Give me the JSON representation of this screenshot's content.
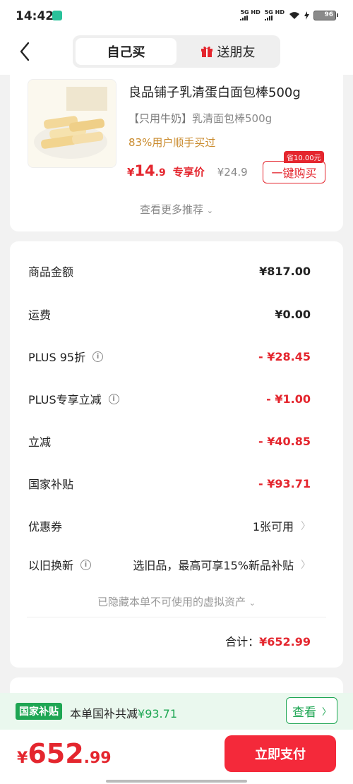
{
  "status": {
    "time": "14:42",
    "net1": "5G HD",
    "net2": "5G HD",
    "battery": "96"
  },
  "header": {
    "tab_self": "自己买",
    "tab_gift": "送朋友"
  },
  "product": {
    "title": "良品铺子乳清蛋白面包棒500g",
    "option_bracket": "【只用牛奶】",
    "option_text": "乳清面包棒500g",
    "buyers": "83%用户顺手买过",
    "price_currency": "¥",
    "price_int": "14",
    "price_dec": ".9",
    "price_tag": "专享价",
    "orig_price": "¥24.9",
    "save_badge": "省10.00元",
    "buy_label": "一键购买",
    "more": "查看更多推荐"
  },
  "summary": {
    "rows": [
      {
        "label": "商品金额",
        "value": "¥817.00"
      },
      {
        "label": "运费",
        "value": "¥0.00"
      },
      {
        "label": "PLUS 95折",
        "value": "- ¥28.45"
      },
      {
        "label": "PLUS专享立减",
        "value": "- ¥1.00"
      },
      {
        "label": "立减",
        "value": "- ¥40.85"
      },
      {
        "label": "国家补贴",
        "value": "- ¥93.71"
      },
      {
        "label": "优惠券",
        "value": "1张可用"
      },
      {
        "label": "以旧换新",
        "value": "选旧品，最高可享15%新品补贴"
      }
    ],
    "hidden_assets": "已隐藏本单不可使用的虚拟资产",
    "total_label": "合计：",
    "total_value": "¥652.99"
  },
  "subsidy": {
    "tag": "国家补贴",
    "text": "本单国补共减",
    "amount": "¥93.71",
    "button": "查看"
  },
  "bottom": {
    "currency": "¥",
    "int": "652",
    "dec": ".99",
    "pay": "立即支付"
  },
  "colors": {
    "accent_red": "#e4262e",
    "green": "#1ea653",
    "gold": "#c98a2c"
  }
}
